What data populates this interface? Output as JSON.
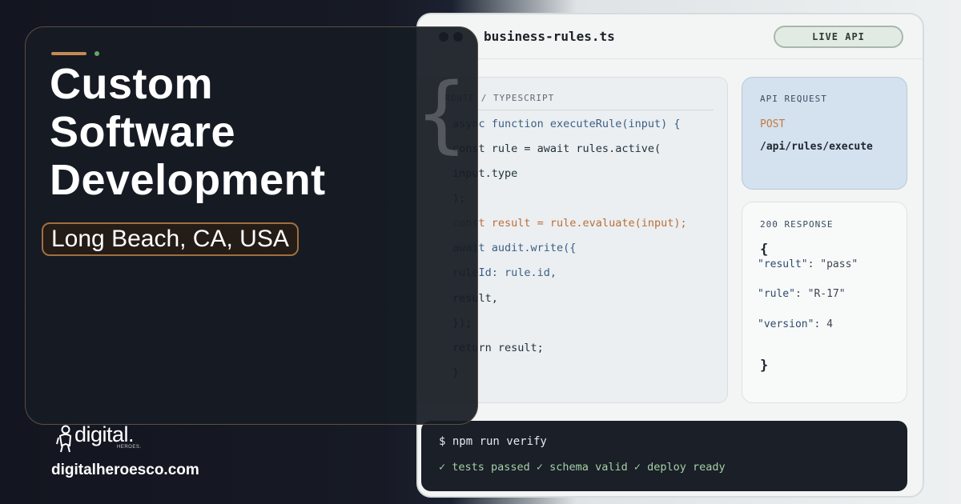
{
  "hero": {
    "headline": [
      "Custom",
      "Software",
      "Development"
    ],
    "location": "Long Beach, CA, USA",
    "brand": "digital.",
    "brand_sub": "HEROES.",
    "website": "digitalheroesco.com"
  },
  "editor": {
    "filename": "business-rules.ts",
    "badge": "LIVE API",
    "code_header": "ROUTE / TYPESCRIPT",
    "code_lines": [
      "async function executeRule(input) {",
      "const rule = await rules.active(",
      "input.type",
      ");",
      "const result = rule.evaluate(input);",
      "await audit.write({",
      "ruleId: rule.id,",
      "result,",
      "});",
      "return result;",
      "}"
    ]
  },
  "request": {
    "label": "API REQUEST",
    "method": "POST",
    "path": "/api/rules/execute"
  },
  "response": {
    "label": "200 RESPONSE",
    "open": "{",
    "close": "}",
    "fields": [
      {
        "key": "\"result\"",
        "value": "\"pass\""
      },
      {
        "key": "\"rule\"",
        "value": "\"R-17\""
      },
      {
        "key": "\"version\"",
        "value": "4"
      }
    ]
  },
  "terminal": {
    "command": "$ npm run verify",
    "status": "✓ tests passed ✓ schema valid ✓ deploy ready"
  },
  "colors": {
    "accent_orange": "#c58a52",
    "accent_green": "#6ba36c",
    "card_bg": "#171c24"
  }
}
